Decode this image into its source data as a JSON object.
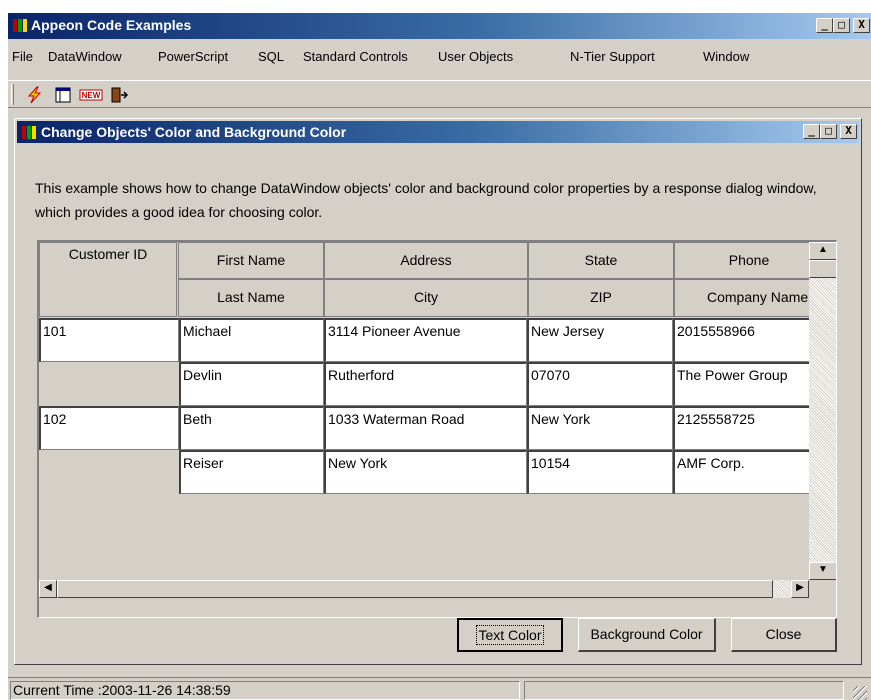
{
  "app": {
    "title": "Appeon Code Examples",
    "minimize": "_",
    "maximize": "□",
    "close": "X"
  },
  "menu": [
    "File",
    "DataWindow",
    "PowerScript",
    "SQL",
    "Standard Controls",
    "User Objects",
    "N-Tier Support",
    "Window"
  ],
  "toolbar": {
    "icons": [
      "lightning-icon",
      "window-icon",
      "new-icon",
      "exit-door-icon"
    ],
    "new_label": "NEW"
  },
  "child": {
    "title": "Change Objects' Color and Background Color",
    "minimize": "_",
    "maximize": "□",
    "close": "X",
    "description": "This example shows how to change DataWindow objects' color and background color properties by a response dialog window, which provides a good idea for choosing color."
  },
  "grid": {
    "headers_top": [
      "Customer ID",
      "First Name",
      "Address",
      "State",
      "Phone"
    ],
    "headers_bottom": [
      "Last Name",
      "City",
      "ZIP",
      "Company Name"
    ],
    "rows": [
      {
        "id": "101",
        "first_name": "Michael",
        "address": "3114 Pioneer Avenue",
        "state": "New Jersey",
        "phone": "2015558966",
        "last_name": "Devlin",
        "city": "Rutherford",
        "zip": "07070",
        "company": "The Power Group"
      },
      {
        "id": "102",
        "first_name": "Beth",
        "address": "1033 Waterman Road",
        "state": "New York",
        "phone": "2125558725",
        "last_name": "Reiser",
        "city": "New York",
        "zip": "10154",
        "company": "AMF Corp."
      }
    ]
  },
  "buttons": {
    "text_color": "Text Color",
    "background_color": "Background Color",
    "close": "Close"
  },
  "status": {
    "text": "Current Time :2003-11-26 14:38:59"
  }
}
